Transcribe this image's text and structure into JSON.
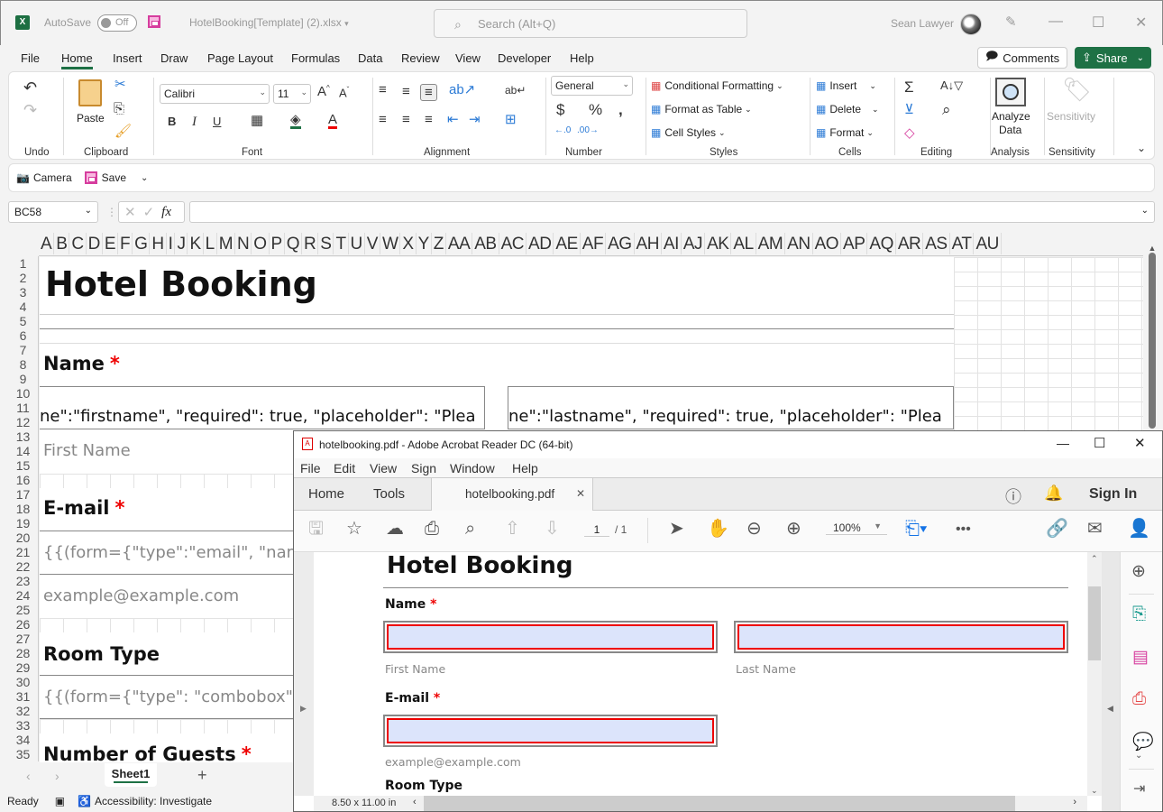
{
  "excel": {
    "title_bar": {
      "autosave_label": "AutoSave",
      "autosave_state": "Off",
      "document_name": "HotelBooking[Template] (2).xlsx",
      "search_placeholder": "Search (Alt+Q)",
      "user_name": "Sean Lawyer"
    },
    "menu": [
      "File",
      "Home",
      "Insert",
      "Draw",
      "Page Layout",
      "Formulas",
      "Data",
      "Review",
      "View",
      "Developer",
      "Help"
    ],
    "active_menu": "Home",
    "comments_label": "Comments",
    "share_label": "Share",
    "ribbon": {
      "groups": {
        "undo": "Undo",
        "clipboard": "Clipboard",
        "font": "Font",
        "alignment": "Alignment",
        "number": "Number",
        "styles": "Styles",
        "cells": "Cells",
        "editing": "Editing",
        "analysis": "Analysis",
        "sensitivity": "Sensitivity"
      },
      "paste_label": "Paste",
      "font_name": "Calibri",
      "font_size": "11",
      "number_format": "General",
      "conditional_formatting": "Conditional Formatting",
      "format_as_table": "Format as Table",
      "cell_styles": "Cell Styles",
      "insert": "Insert",
      "delete": "Delete",
      "format": "Format",
      "analyze_data_1": "Analyze",
      "analyze_data_2": "Data",
      "sensitivity_btn": "Sensitivity"
    },
    "qat": {
      "camera": "Camera",
      "save": "Save"
    },
    "name_box": "BC58",
    "formula_value": "",
    "columns": [
      "A",
      "B",
      "C",
      "D",
      "E",
      "F",
      "G",
      "H",
      "I",
      "J",
      "K",
      "L",
      "M",
      "N",
      "O",
      "P",
      "Q",
      "R",
      "S",
      "T",
      "U",
      "V",
      "W",
      "X",
      "Y",
      "Z",
      "AA",
      "AB",
      "AC",
      "AD",
      "AE",
      "AF",
      "AG",
      "AH",
      "AI",
      "AJ",
      "AK",
      "AL",
      "AM",
      "AN",
      "AO",
      "AP",
      "AQ",
      "AR",
      "AS",
      "AT",
      "AU"
    ],
    "rows": [
      "1",
      "2",
      "3",
      "4",
      "5",
      "6",
      "7",
      "8",
      "9",
      "10",
      "11",
      "12",
      "13",
      "14",
      "15",
      "16",
      "17",
      "18",
      "19",
      "20",
      "21",
      "22",
      "23",
      "24",
      "25",
      "26",
      "27",
      "28",
      "29",
      "30",
      "31",
      "32",
      "33",
      "34",
      "35"
    ],
    "sheet": {
      "title": "Hotel Booking",
      "name_label": "Name",
      "required_mark": "*",
      "firstname_code": "ne\":\"firstname\", \"required\": true, \"placeholder\": \"Plea",
      "lastname_code": "ne\":\"lastname\", \"required\": true, \"placeholder\": \"Plea",
      "first_name_hint": "First Name",
      "email_label": "E-mail",
      "email_code": "{{(form={\"type\":\"email\", \"nam",
      "email_hint": "example@example.com",
      "room_type_label": "Room Type",
      "room_type_code": "{{(form={\"type\": \"combobox\",",
      "guests_label": "Number of Guests"
    },
    "sheet_tab": "Sheet1",
    "status": {
      "ready": "Ready",
      "accessibility": "Accessibility: Investigate"
    }
  },
  "acrobat": {
    "title": "hotelbooking.pdf - Adobe Acrobat Reader DC (64-bit)",
    "menu": [
      "File",
      "Edit",
      "View",
      "Sign",
      "Window",
      "Help"
    ],
    "tabs": {
      "home": "Home",
      "tools": "Tools",
      "document": "hotelbooking.pdf"
    },
    "sign_in": "Sign In",
    "page_current": "1",
    "page_total": "/ 1",
    "zoom": "100%",
    "page_size": "8.50 x 11.00 in",
    "pdf": {
      "title": "Hotel Booking",
      "name_label": "Name",
      "required_mark": "*",
      "first_name": "First Name",
      "last_name": "Last Name",
      "email_label": "E-mail",
      "email_hint": "example@example.com",
      "room_type_label": "Room Type"
    }
  },
  "colors": {
    "excel_green": "#1e7145",
    "required_red": "#e00000",
    "field_fill": "#dce4fb",
    "acrobat_blue": "#1473e6"
  }
}
